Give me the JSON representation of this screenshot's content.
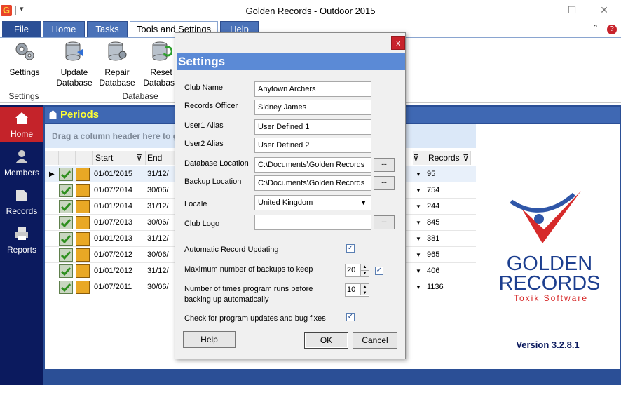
{
  "window": {
    "title": "Golden Records - Outdoor 2015",
    "app_icon_letter": "G",
    "minimize": "—",
    "maximize": "☐",
    "close": "✕"
  },
  "ribbon": {
    "tabs": [
      "File",
      "Home",
      "Tasks",
      "Tools and Settings",
      "Help"
    ],
    "active_tab": "Tools and Settings",
    "groups": [
      {
        "label": "Settings",
        "buttons": [
          {
            "label": "Settings",
            "icon": "gears-icon"
          }
        ]
      },
      {
        "label": "Database",
        "buttons": [
          {
            "label": "Update\nDatabase",
            "icon": "database-update-icon"
          },
          {
            "label": "Repair\nDatabase",
            "icon": "database-repair-icon"
          },
          {
            "label": "Reset\nDatabase",
            "icon": "database-reset-icon"
          }
        ]
      }
    ]
  },
  "nav": {
    "items": [
      {
        "label": "Home",
        "icon": "home-icon",
        "active": true
      },
      {
        "label": "Members",
        "icon": "person-icon",
        "active": false
      },
      {
        "label": "Records",
        "icon": "records-icon",
        "active": false
      },
      {
        "label": "Reports",
        "icon": "printer-icon",
        "active": false
      }
    ]
  },
  "periods": {
    "title": "Periods",
    "group_panel_text": "Drag a column header here to g",
    "columns": {
      "start": "Start",
      "end": "End",
      "records": "Records"
    },
    "rows": [
      {
        "start": "01/01/2015",
        "end": "31/12/",
        "records": "95",
        "selected": true
      },
      {
        "start": "01/07/2014",
        "end": "30/06/",
        "records": "754",
        "selected": false
      },
      {
        "start": "01/01/2014",
        "end": "31/12/",
        "records": "244",
        "selected": false
      },
      {
        "start": "01/07/2013",
        "end": "30/06/",
        "records": "845",
        "selected": false
      },
      {
        "start": "01/01/2013",
        "end": "31/12/",
        "records": "381",
        "selected": false
      },
      {
        "start": "01/07/2012",
        "end": "30/06/",
        "records": "965",
        "selected": false
      },
      {
        "start": "01/01/2012",
        "end": "31/12/",
        "records": "406",
        "selected": false
      },
      {
        "start": "01/07/2011",
        "end": "30/06/",
        "records": "1136",
        "selected": false
      }
    ]
  },
  "logo": {
    "line1": "GOLDEN",
    "line2": "RECORDS",
    "tagline": "Toxik Software"
  },
  "version": "Version 3.2.8.1",
  "settings_dialog": {
    "title": "Settings",
    "close": "x",
    "fields": {
      "club_name": {
        "label": "Club Name",
        "value": "Anytown Archers"
      },
      "records_officer": {
        "label": "Records Officer",
        "value": "Sidney James"
      },
      "user1_alias": {
        "label": "User1 Alias",
        "value": "User Defined 1"
      },
      "user2_alias": {
        "label": "User2 Alias",
        "value": "User Defined 2"
      },
      "database_location": {
        "label": "Database Location",
        "value": "C:\\Documents\\Golden Records"
      },
      "backup_location": {
        "label": "Backup Location",
        "value": "C:\\Documents\\Golden Records"
      },
      "locale": {
        "label": "Locale",
        "value": "United Kingdom"
      },
      "club_logo": {
        "label": "Club Logo",
        "value": ""
      }
    },
    "browse_label": "...",
    "auto_record_updating": {
      "label": "Automatic Record Updating",
      "checked": true
    },
    "max_backups": {
      "label": "Maximum number of backups to keep",
      "value": "20",
      "checked": true
    },
    "runs_before_backup": {
      "label": "Number of times program runs before\nbacking up automatically",
      "value": "10"
    },
    "check_updates": {
      "label": "Check for program updates and bug fixes",
      "checked": true
    },
    "buttons": {
      "help": "Help",
      "ok": "OK",
      "cancel": "Cancel"
    }
  },
  "colors": {
    "nav_bg": "#0b1a5e",
    "nav_active": "#c4232a",
    "main_bg": "#2b4f96",
    "dialog_header": "#5b8ad6",
    "periods_title": "#ffff33"
  }
}
